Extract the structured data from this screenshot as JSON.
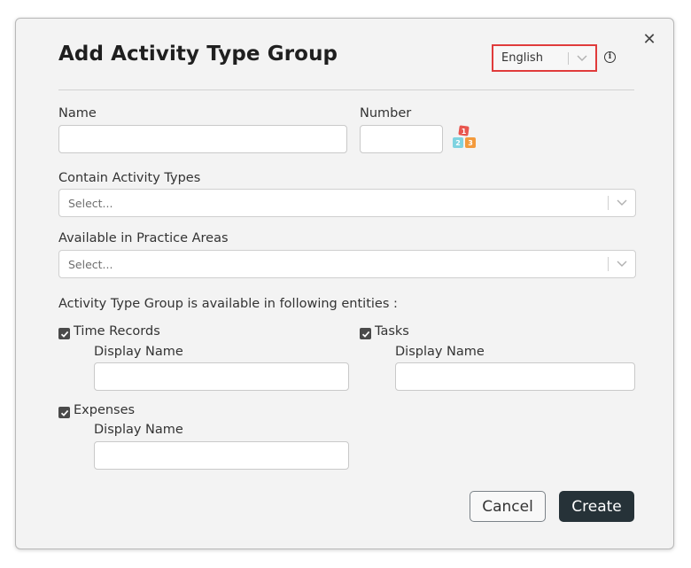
{
  "dialog": {
    "title": "Add Activity Type Group",
    "close_glyph": "✕",
    "language": {
      "selected": "English"
    },
    "info_glyph": "i"
  },
  "form": {
    "name_label": "Name",
    "number_label": "Number",
    "number_icon": "numbered-blocks-icon",
    "contain_label": "Contain Activity Types",
    "contain_placeholder": "Select...",
    "practice_label": "Available in Practice Areas",
    "practice_placeholder": "Select...",
    "entities_label": "Activity Type Group is available in following entities :",
    "entities": [
      {
        "label": "Time Records",
        "checked": true,
        "display_name_label": "Display Name",
        "display_name_value": ""
      },
      {
        "label": "Tasks",
        "checked": true,
        "display_name_label": "Display Name",
        "display_name_value": ""
      },
      {
        "label": "Expenses",
        "checked": true,
        "display_name_label": "Display Name",
        "display_name_value": ""
      }
    ]
  },
  "buttons": {
    "cancel": "Cancel",
    "create": "Create"
  },
  "colors": {
    "dialog_bg": "#f3f3f3",
    "highlight_border": "#e03b3b",
    "primary_button": "#263238",
    "checkbox": "#4a4a4a"
  }
}
